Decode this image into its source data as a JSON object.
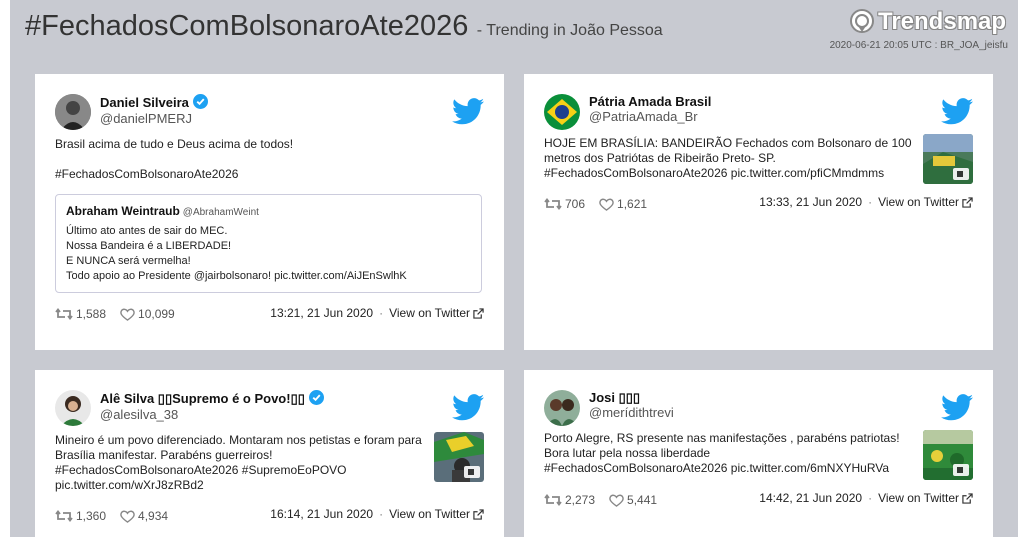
{
  "header": {
    "hashtag": "#FechadosComBolsonaroAte2026",
    "subtitle": "- Trending in João Pessoa",
    "brand": "Trendsmap",
    "stamp": "2020-06-21 20:05 UTC : BR_JOA_jeisfu"
  },
  "colors": {
    "background": "#c8cad1",
    "twitter_blue": "#1da1f2",
    "verified": "#1da1f2"
  },
  "cards": [
    {
      "name": "Daniel Silveira",
      "handle": "@danielPMERJ",
      "verified": true,
      "text": [
        "Brasil acima de tudo e Deus acima de todos!",
        "",
        "#FechadosComBolsonaroAte2026"
      ],
      "quote": {
        "name": "Abraham Weintraub",
        "handle": "@AbrahamWeint",
        "text": [
          "Último ato antes de sair do MEC.",
          "Nossa Bandeira é a LIBERDADE!",
          "E NUNCA será vermelha!",
          "Todo apoio ao Presidente @jairbolsonaro! pic.twitter.com/AiJEnSwlhK"
        ]
      },
      "retweets": "1,588",
      "likes": "10,099",
      "time": "13:21, 21 Jun 2020",
      "view_link": "View on Twitter"
    },
    {
      "name": "Pátria Amada Brasil",
      "handle": "@PatriaAmada_Br",
      "verified": false,
      "text": [
        "HOJE EM BRASÍLIA: BANDEIRÃO Fechados com Bolsonaro de 100",
        "metros dos Patriótas de Ribeirão Preto- SP.",
        "#FechadosComBolsonaroAte2026 pic.twitter.com/pfiCMmdmms"
      ],
      "retweets": "706",
      "likes": "1,621",
      "time": "13:33, 21 Jun 2020",
      "view_link": "View on Twitter"
    },
    {
      "name": "Alê Silva ▯▯Supremo é o Povo!▯▯",
      "handle": "@alesilva_38",
      "verified": true,
      "text": [
        "Mineiro é um povo diferenciado. Montaram nos petistas e foram para",
        "Brasília manifestar. Parabéns guerreiros!",
        "#FechadosComBolsonaroAte2026 #SupremoEoPOVO",
        "pic.twitter.com/wXrJ8zRBd2"
      ],
      "retweets": "1,360",
      "likes": "4,934",
      "time": "16:14, 21 Jun 2020",
      "view_link": "View on Twitter"
    },
    {
      "name": "Josi ▯▯▯",
      "handle": "@merídithtrevi",
      "verified": false,
      "text": [
        "Porto Alegre, RS presente nas manifestações , parabéns patriotas!",
        "Bora lutar pela nossa liberdade",
        "#FechadosComBolsonaroAte2026 pic.twitter.com/6mNXYHuRVa"
      ],
      "retweets": "2,273",
      "likes": "5,441",
      "time": "14:42, 21 Jun 2020",
      "view_link": "View on Twitter"
    }
  ]
}
